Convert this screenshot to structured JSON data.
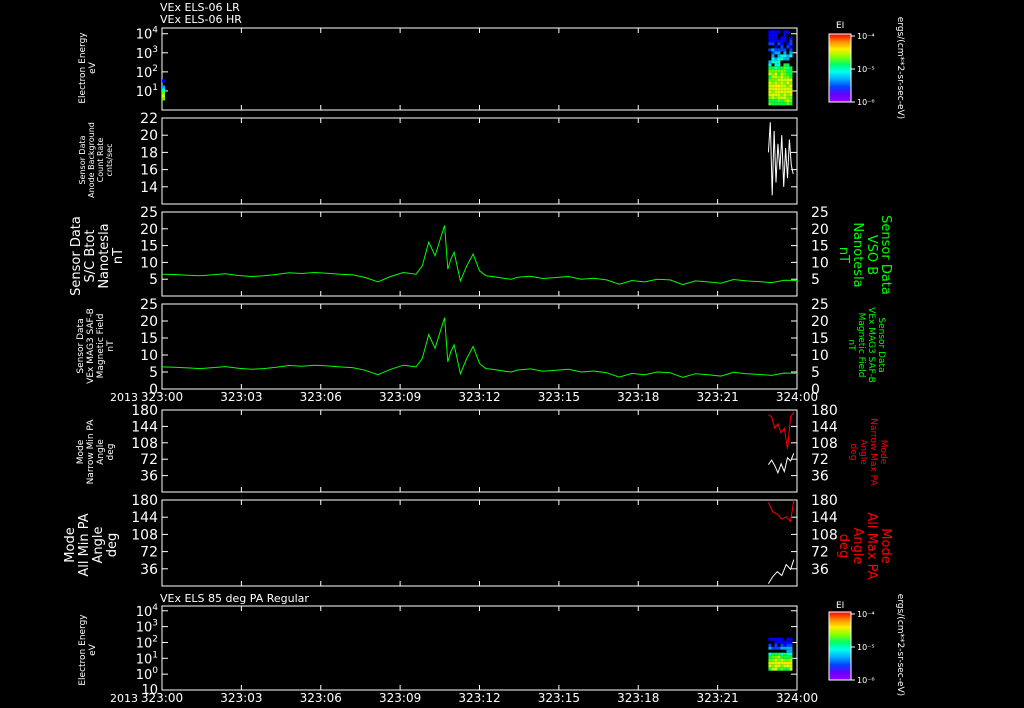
{
  "header": {
    "line1": "VEx ELS-06 LR",
    "line2": "VEx ELS-06 HR"
  },
  "panel7_header": "VEx ELS 85 deg PA Regular",
  "year_label": "2013",
  "time_ticks": [
    "323:00",
    "323:03",
    "323:06",
    "323:09",
    "323:12",
    "323:15",
    "323:18",
    "323:21",
    "324:00"
  ],
  "panels": {
    "p1": {
      "ylabel_lines": [
        "Electron Energy",
        "eV"
      ]
    },
    "p2": {
      "ylabel_lines": [
        "Sensor Data",
        "Anode Background",
        "Count Rate",
        "cnts/sec"
      ]
    },
    "p3": {
      "ylabel_lines": [
        "Sensor Data",
        "S/C Btot",
        "Nanotesla",
        "nT"
      ],
      "right_label_lines": [
        "Sensor Data",
        "VSO B",
        "Nanotesla",
        "nT"
      ]
    },
    "p4": {
      "ylabel_lines": [
        "Sensor Data",
        "VEx MAG3 SAF-B",
        "Magnetic Field",
        "nT"
      ],
      "right_label_lines": [
        "Sensor Data",
        "VEx MAG3 SAF-B",
        "Magnetic Field",
        "nT"
      ]
    },
    "p5": {
      "ylabel_lines": [
        "Mode",
        "Narrow Min PA",
        "Angle",
        "deg"
      ],
      "right_label_lines": [
        "Mode",
        "Narrow Max PA",
        "Angle",
        "deg"
      ]
    },
    "p6": {
      "ylabel_lines": [
        "Mode",
        "All Min PA",
        "Angle",
        "deg"
      ],
      "right_label_lines": [
        "Mode",
        "All Max PA",
        "Angle",
        "deg"
      ]
    },
    "p7": {
      "ylabel_lines": [
        "Electron Energy",
        "eV"
      ]
    }
  },
  "colorbar": {
    "title": "EI",
    "ticks": [
      "10⁻⁴",
      "10⁻⁵",
      "10⁻⁶"
    ],
    "units": "ergs/(cm**2-sr-sec-eV)"
  },
  "colors": {
    "white": "#ffffff",
    "green": "#00ff00",
    "red": "#ff0000",
    "background": "#000000"
  },
  "chart_data": [
    {
      "type": "heatmap",
      "panel": "p1",
      "yscale": "log",
      "ylim": [
        1,
        20000
      ],
      "y_ticks": [
        {
          "text": "10",
          "sup": "1",
          "value": 10
        },
        {
          "text": "10",
          "sup": "2",
          "value": 100
        },
        {
          "text": "10",
          "sup": "3",
          "value": 1000
        },
        {
          "text": "10",
          "sup": "4",
          "value": 10000
        }
      ],
      "xlim_hours": [
        0,
        1
      ],
      "data_regions": [
        {
          "x_start_hours": 0.0,
          "x_end_hours": 0.005,
          "y_low": 3,
          "y_high": 40
        },
        {
          "x_start_hours": 0.955,
          "x_end_hours": 0.995,
          "y_low": 2,
          "y_high": 15000
        }
      ]
    },
    {
      "type": "line",
      "panel": "p2",
      "ylim": [
        12,
        22
      ],
      "y_ticks": [
        14,
        16,
        18,
        20,
        22
      ],
      "series": [
        {
          "color": "#ffffff",
          "x": [
            0.955,
            0.958,
            0.961,
            0.964,
            0.967,
            0.97,
            0.973,
            0.976,
            0.979,
            0.982,
            0.985,
            0.988,
            0.991,
            0.994
          ],
          "y": [
            18.0,
            21.5,
            13.0,
            20.5,
            14.5,
            19.0,
            16.0,
            20.0,
            14.0,
            18.5,
            15.0,
            19.5,
            16.5,
            15.5
          ]
        }
      ]
    },
    {
      "type": "line",
      "panel": "p3",
      "ylim": [
        0,
        25
      ],
      "y_ticks": [
        5,
        10,
        15,
        20,
        25
      ],
      "series": [
        {
          "color": "#00ff00",
          "x": [
            0.0,
            0.02,
            0.04,
            0.06,
            0.08,
            0.1,
            0.12,
            0.14,
            0.16,
            0.18,
            0.2,
            0.22,
            0.24,
            0.26,
            0.28,
            0.3,
            0.32,
            0.34,
            0.36,
            0.38,
            0.4,
            0.41,
            0.42,
            0.43,
            0.44,
            0.445,
            0.45,
            0.455,
            0.46,
            0.47,
            0.48,
            0.49,
            0.5,
            0.51,
            0.52,
            0.53,
            0.54,
            0.55,
            0.56,
            0.58,
            0.6,
            0.62,
            0.64,
            0.66,
            0.68,
            0.7,
            0.72,
            0.74,
            0.76,
            0.78,
            0.8,
            0.82,
            0.84,
            0.86,
            0.88,
            0.9,
            0.92,
            0.94,
            0.96,
            0.98,
            1.0
          ],
          "y": [
            6.5,
            6.4,
            6.2,
            6.0,
            6.3,
            6.6,
            6.1,
            5.8,
            6.0,
            6.4,
            6.9,
            6.7,
            7.0,
            6.8,
            6.5,
            6.3,
            5.5,
            4.2,
            5.8,
            7.0,
            6.5,
            9.0,
            16.0,
            12.0,
            18.0,
            21.0,
            8.0,
            11.0,
            13.0,
            4.5,
            9.0,
            12.5,
            7.5,
            6.0,
            5.8,
            5.5,
            5.2,
            5.0,
            5.6,
            5.9,
            5.2,
            5.5,
            5.8,
            5.0,
            5.3,
            4.8,
            3.5,
            4.6,
            4.2,
            5.0,
            4.8,
            3.4,
            4.5,
            4.2,
            3.8,
            4.9,
            4.5,
            4.3,
            4.0,
            4.7,
            4.6
          ]
        }
      ]
    },
    {
      "type": "line",
      "panel": "p4",
      "ylim": [
        0,
        25
      ],
      "y_ticks": [
        0,
        5,
        10,
        15,
        20,
        25
      ],
      "series": [
        {
          "color": "#00ff00",
          "x": [
            0.0,
            0.02,
            0.04,
            0.06,
            0.08,
            0.1,
            0.12,
            0.14,
            0.16,
            0.18,
            0.2,
            0.22,
            0.24,
            0.26,
            0.28,
            0.3,
            0.32,
            0.34,
            0.36,
            0.38,
            0.4,
            0.41,
            0.42,
            0.43,
            0.44,
            0.445,
            0.45,
            0.455,
            0.46,
            0.47,
            0.48,
            0.49,
            0.5,
            0.51,
            0.52,
            0.53,
            0.54,
            0.55,
            0.56,
            0.58,
            0.6,
            0.62,
            0.64,
            0.66,
            0.68,
            0.7,
            0.72,
            0.74,
            0.76,
            0.78,
            0.8,
            0.82,
            0.84,
            0.86,
            0.88,
            0.9,
            0.92,
            0.94,
            0.96,
            0.98,
            1.0
          ],
          "y": [
            6.5,
            6.4,
            6.2,
            6.0,
            6.3,
            6.6,
            6.1,
            5.8,
            6.0,
            6.4,
            6.9,
            6.7,
            7.0,
            6.8,
            6.5,
            6.3,
            5.5,
            4.2,
            5.8,
            7.0,
            6.5,
            9.0,
            16.0,
            12.0,
            18.0,
            21.0,
            8.0,
            11.0,
            13.0,
            4.5,
            9.0,
            12.5,
            7.5,
            6.0,
            5.8,
            5.5,
            5.2,
            5.0,
            5.6,
            5.9,
            5.2,
            5.5,
            5.8,
            5.0,
            5.3,
            4.8,
            3.5,
            4.6,
            4.2,
            5.0,
            4.8,
            3.4,
            4.5,
            4.2,
            3.8,
            4.9,
            4.5,
            4.3,
            4.0,
            4.7,
            4.6
          ]
        }
      ]
    },
    {
      "type": "line",
      "panel": "p5",
      "ylim": [
        0,
        180
      ],
      "y_ticks": [
        36,
        72,
        108,
        144,
        180
      ],
      "series": [
        {
          "color": "#ff0000",
          "x": [
            0.955,
            0.96,
            0.965,
            0.97,
            0.975,
            0.98,
            0.985,
            0.99,
            0.995
          ],
          "y": [
            170,
            165,
            140,
            150,
            130,
            140,
            95,
            165,
            175
          ]
        },
        {
          "color": "#ffffff",
          "x": [
            0.955,
            0.96,
            0.965,
            0.97,
            0.975,
            0.98,
            0.985,
            0.99,
            0.995
          ],
          "y": [
            60,
            70,
            58,
            42,
            62,
            45,
            75,
            68,
            85
          ]
        }
      ]
    },
    {
      "type": "line",
      "panel": "p6",
      "ylim": [
        0,
        180
      ],
      "y_ticks": [
        36,
        72,
        108,
        144,
        180
      ],
      "series": [
        {
          "color": "#ff0000",
          "x": [
            0.955,
            0.962,
            0.969,
            0.976,
            0.983,
            0.99,
            0.995
          ],
          "y": [
            175,
            155,
            150,
            140,
            145,
            135,
            180
          ]
        },
        {
          "color": "#ffffff",
          "x": [
            0.955,
            0.962,
            0.969,
            0.976,
            0.983,
            0.99,
            0.995
          ],
          "y": [
            5,
            20,
            30,
            22,
            45,
            35,
            55
          ]
        }
      ]
    },
    {
      "type": "heatmap",
      "panel": "p7",
      "yscale": "log",
      "ylim": [
        0.1,
        20000
      ],
      "y_ticks": [
        {
          "text": "10",
          "sup": "0",
          "value": 1
        },
        {
          "text": "10",
          "sup": "1",
          "value": 10
        },
        {
          "text": "10",
          "sup": "2",
          "value": 100
        },
        {
          "text": "10",
          "sup": "3",
          "value": 1000
        },
        {
          "text": "10",
          "sup": "4",
          "value": 10000
        }
      ],
      "xlim_hours": [
        0,
        1
      ],
      "data_regions": [
        {
          "x_start_hours": 0.955,
          "x_end_hours": 0.995,
          "y_low": 2,
          "y_high": 200
        }
      ]
    }
  ]
}
